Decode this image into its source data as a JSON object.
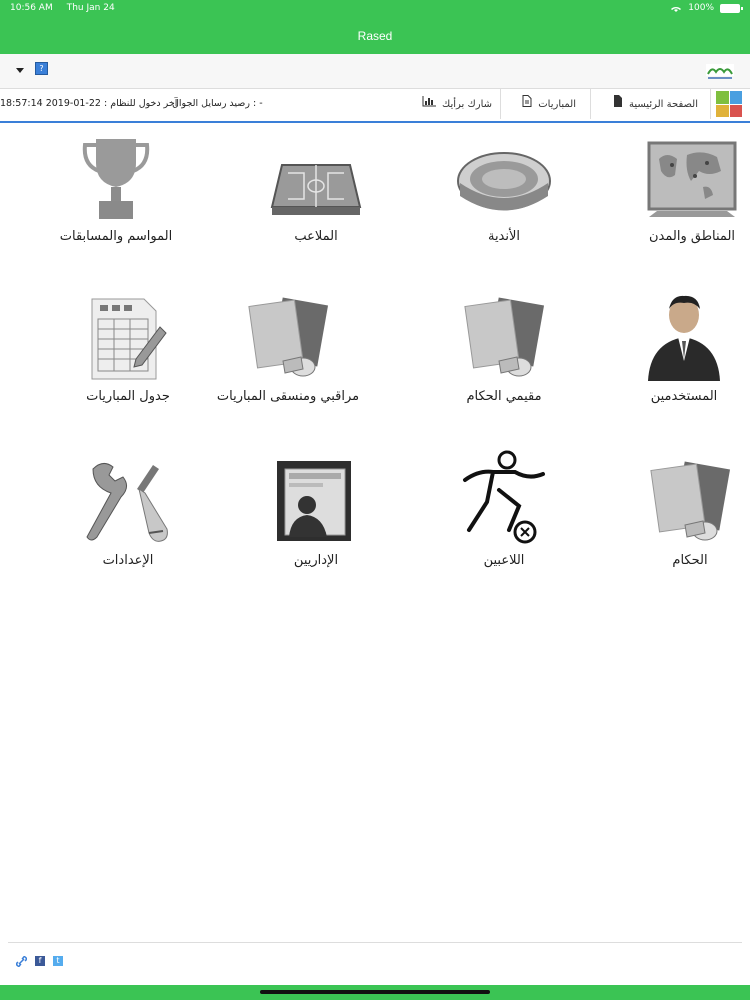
{
  "status": {
    "time": "10:56 AM",
    "date": "Thu Jan 24",
    "battery": "100%"
  },
  "app": {
    "title": "Rased"
  },
  "menu": {
    "home": "الصفحة الرئيسية",
    "matches": "المباريات",
    "share": "شارك برأيك",
    "sms_balance": "رصيد رسايل الجوال : -",
    "last_login": "آخر دخول للنظام : 22-01-2019 18:57:14"
  },
  "tiles": [
    {
      "label": "المناطق والمدن",
      "icon": "world-map-icon"
    },
    {
      "label": "الأندية",
      "icon": "stadium-icon"
    },
    {
      "label": "الملاعب",
      "icon": "football-pitch-icon"
    },
    {
      "label": "المواسم والمسابقات",
      "icon": "trophy-icon"
    },
    {
      "label": "المستخدمين",
      "icon": "user-icon"
    },
    {
      "label": "مقيمي الحكام",
      "icon": "cards-whistle-icon"
    },
    {
      "label": "مراقبي ومنسقى المباريات",
      "icon": "cards-whistle-icon"
    },
    {
      "label": "جدول المباريات",
      "icon": "schedule-sheet-icon"
    },
    {
      "label": "الحكام",
      "icon": "cards-whistle-icon"
    },
    {
      "label": "اللاعبين",
      "icon": "player-kick-icon"
    },
    {
      "label": "الإداريين",
      "icon": "admin-folder-icon"
    },
    {
      "label": "الإعدادات",
      "icon": "wrench-screwdriver-icon"
    }
  ],
  "footer": {
    "icons": [
      "link-icon",
      "facebook-icon",
      "twitter-icon"
    ]
  },
  "colors": {
    "brand_green": "#3bc454",
    "accent_blue": "#3a7fd8"
  }
}
